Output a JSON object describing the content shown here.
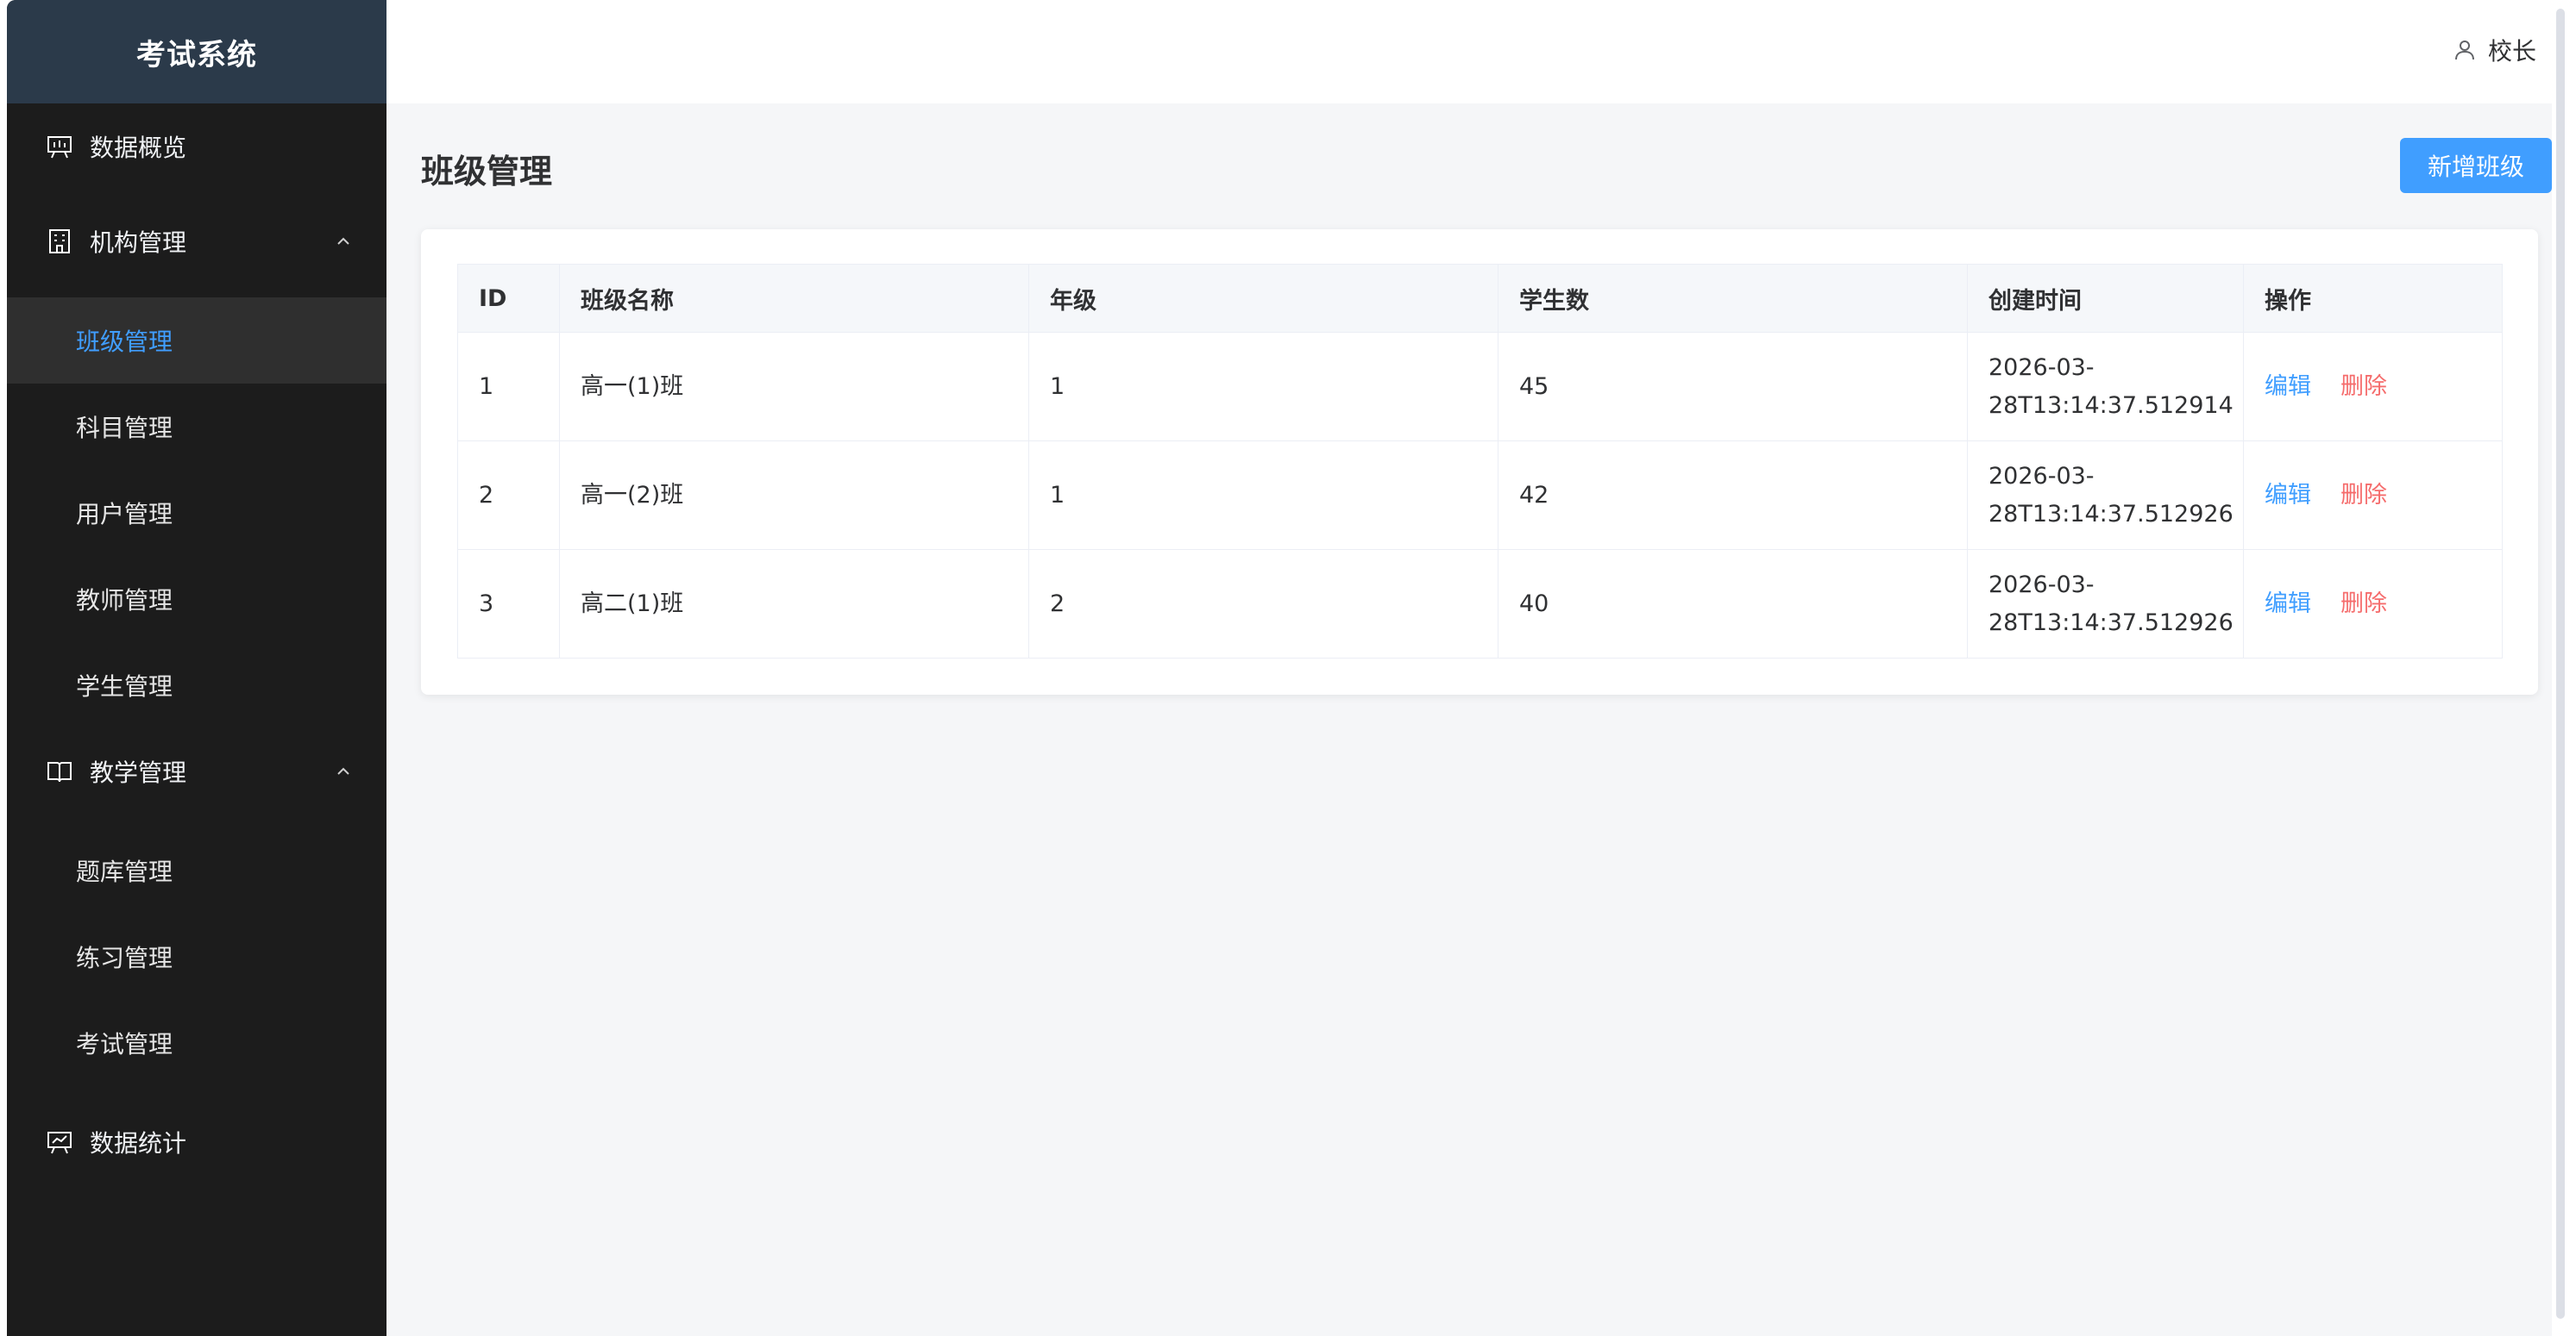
{
  "sidebar": {
    "logo": "考试系统",
    "items": [
      {
        "label": "数据概览",
        "icon": "presentation-icon"
      },
      {
        "label": "机构管理",
        "icon": "building-icon"
      },
      {
        "label": "班级管理"
      },
      {
        "label": "科目管理"
      },
      {
        "label": "用户管理"
      },
      {
        "label": "教师管理"
      },
      {
        "label": "学生管理"
      },
      {
        "label": "教学管理",
        "icon": "book-icon"
      },
      {
        "label": "题库管理"
      },
      {
        "label": "练习管理"
      },
      {
        "label": "考试管理"
      },
      {
        "label": "数据统计",
        "icon": "chart-icon"
      }
    ]
  },
  "header": {
    "user": "校长"
  },
  "main": {
    "title": "班级管理",
    "add_button": "新增班级"
  },
  "table": {
    "columns": [
      "ID",
      "班级名称",
      "年级",
      "学生数",
      "创建时间",
      "操作"
    ],
    "rows": [
      {
        "id": "1",
        "name": "高一(1)班",
        "grade": "1",
        "students": "45",
        "created_a": "2026-03-",
        "created_b": "28T13:14:37.512914",
        "edit": "编辑",
        "delete": "删除"
      },
      {
        "id": "2",
        "name": "高一(2)班",
        "grade": "1",
        "students": "42",
        "created_a": "2026-03-",
        "created_b": "28T13:14:37.512926",
        "edit": "编辑",
        "delete": "删除"
      },
      {
        "id": "3",
        "name": "高二(1)班",
        "grade": "2",
        "students": "40",
        "created_a": "2026-03-",
        "created_b": "28T13:14:37.512926",
        "edit": "编辑",
        "delete": "删除"
      }
    ]
  },
  "colors": {
    "accent": "#409eff",
    "danger": "#f56c6c",
    "sidebar_bg": "#1c1c1c",
    "logo_bg": "#2b3a4a"
  }
}
